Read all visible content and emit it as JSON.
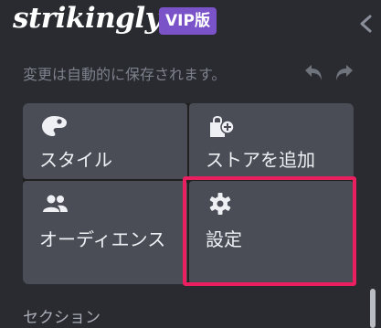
{
  "header": {
    "logo_text": "strikingly",
    "badge": "VIP版"
  },
  "autosave": "変更は自動的に保存されます。",
  "tiles": [
    {
      "label": "スタイル",
      "icon": "palette-icon"
    },
    {
      "label": "ストアを追加",
      "icon": "shopping-bag-add-icon"
    },
    {
      "label": "オーディエンス",
      "icon": "people-icon"
    },
    {
      "label": "設定",
      "icon": "gear-icon"
    }
  ],
  "section_heading": "セクション",
  "colors": {
    "background": "#2a2b30",
    "tile": "#4a4d56",
    "badge": "#7b53c9",
    "highlight": "#ea1f5f"
  }
}
